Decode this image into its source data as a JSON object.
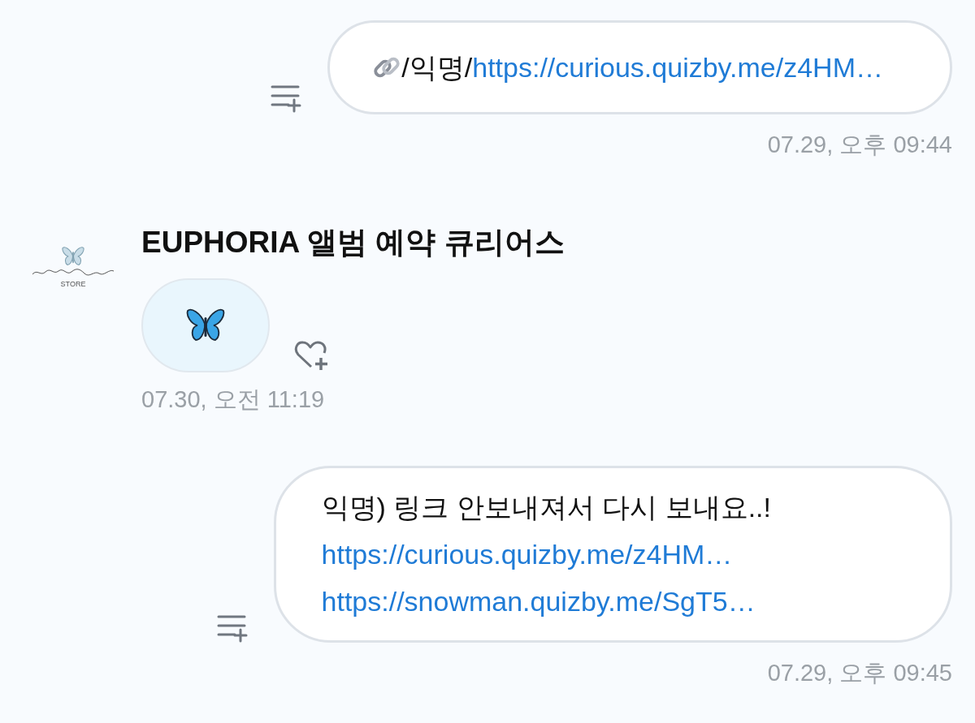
{
  "messages": [
    {
      "kind": "outgoing",
      "lines": [
        [
          {
            "kind": "chain-icon"
          },
          {
            "kind": "text",
            "text": "/익명/"
          },
          {
            "kind": "link",
            "text": "https://curious.quizby.me/z4HM…"
          }
        ]
      ],
      "time": "07.29, 오후 09:44"
    },
    {
      "kind": "incoming",
      "sender": "EUPHORIA 앨범 예약 큐리어스",
      "avatar_caption": "STORE",
      "time": "07.30, 오전 11:19"
    },
    {
      "kind": "outgoing",
      "lines": [
        [
          {
            "kind": "text",
            "text": "익명) 링크 안보내져서 다시 보내요..!"
          }
        ],
        [
          {
            "kind": "link",
            "text": "https://curious.quizby.me/z4HM…"
          }
        ],
        [
          {
            "kind": "link",
            "text": "https://snowman.quizby.me/SgT5…"
          }
        ]
      ],
      "time": "07.29, 오후 09:45"
    }
  ]
}
